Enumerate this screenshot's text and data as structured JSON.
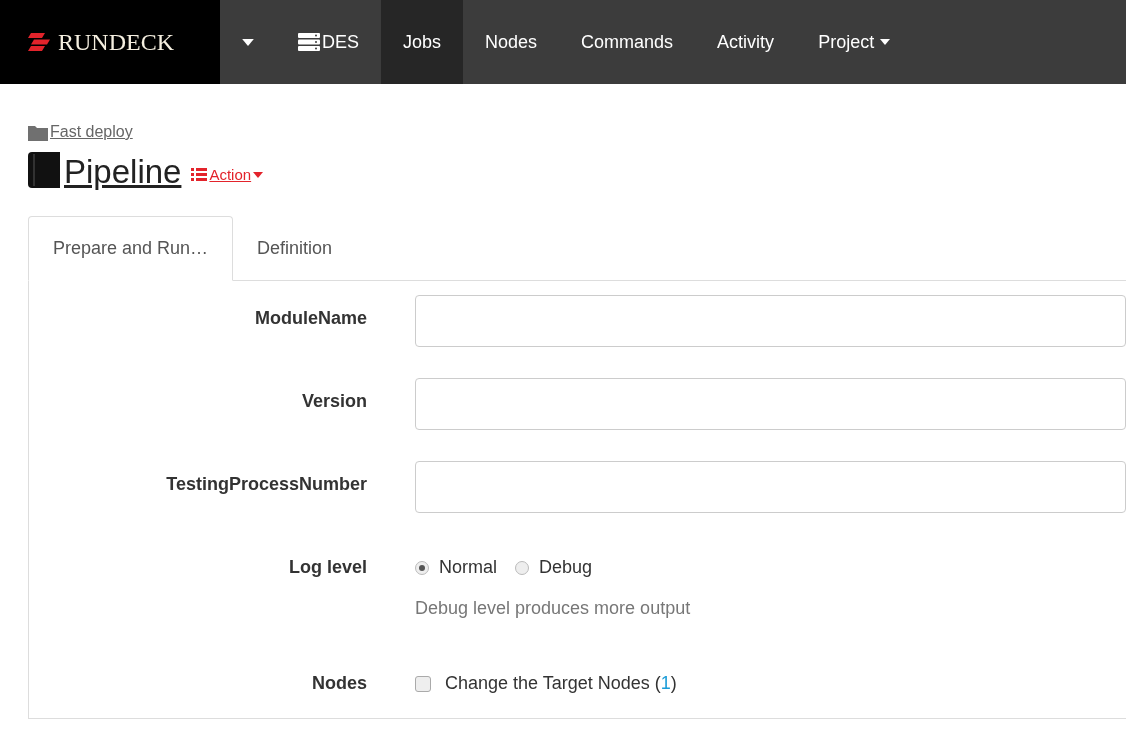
{
  "navbar": {
    "brand": "RUNDECK",
    "project": "DES",
    "items": [
      {
        "label": "Jobs",
        "selected": true,
        "caret": false
      },
      {
        "label": "Nodes",
        "selected": false,
        "caret": false
      },
      {
        "label": "Commands",
        "selected": false,
        "caret": false
      },
      {
        "label": "Activity",
        "selected": false,
        "caret": false
      },
      {
        "label": "Project",
        "selected": false,
        "caret": true
      }
    ]
  },
  "breadcrumb": "Fast deploy",
  "title": "Pipeline",
  "action": "Action",
  "tabs": [
    {
      "label": "Prepare and Run…",
      "selected": true
    },
    {
      "label": "Definition",
      "selected": false
    }
  ],
  "fields": [
    {
      "kind": "text",
      "label": "ModuleName"
    },
    {
      "kind": "text",
      "label": "Version"
    },
    {
      "kind": "text",
      "label": "TestingProcessNumber"
    },
    {
      "kind": "radio",
      "label": "Log level",
      "options": [
        {
          "label": "Normal",
          "selected": true
        },
        {
          "label": "Debug",
          "selected": false
        }
      ],
      "help": "Debug level produces more output"
    },
    {
      "kind": "checkbox",
      "label": "Nodes",
      "checked": false,
      "text_before": "Change the Target Nodes (",
      "count": "1",
      "text_after": ")"
    }
  ]
}
